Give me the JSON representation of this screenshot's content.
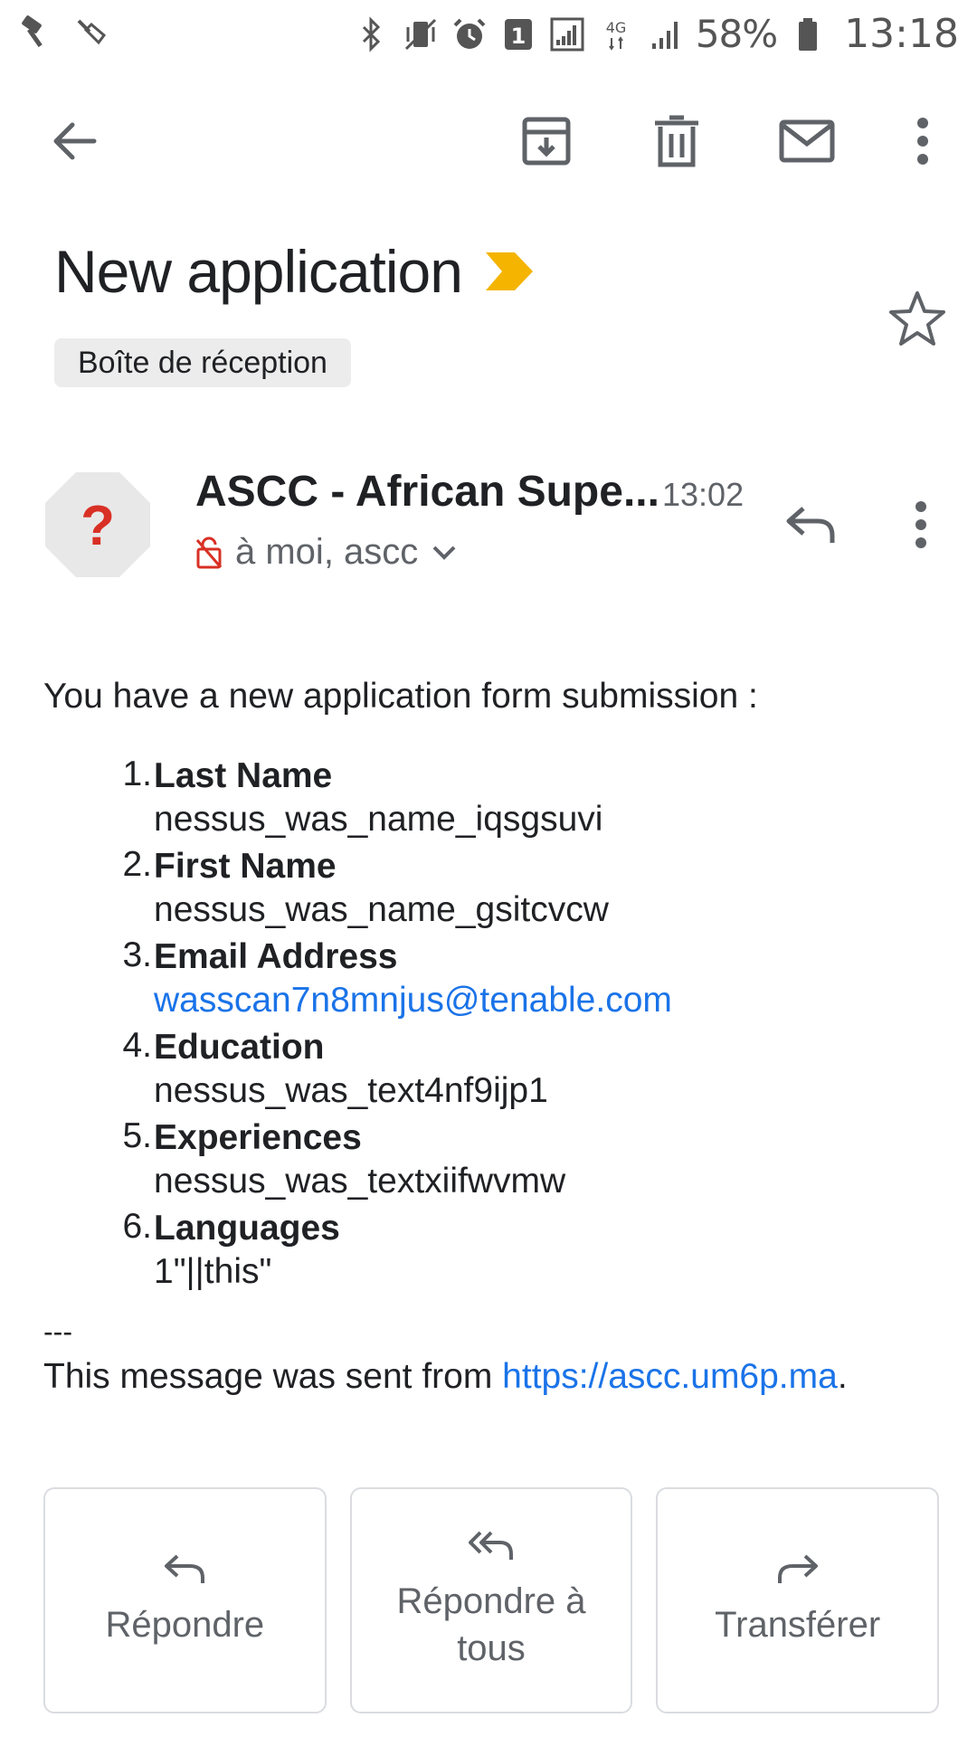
{
  "status_bar": {
    "battery": "58%",
    "time": "13:18",
    "network": "4G",
    "notification_count": "1",
    "icons": [
      "hammer-icon",
      "broom-icon",
      "bluetooth-icon",
      "vibrate-icon",
      "alarm-icon",
      "notification-badge-icon",
      "signal-icon",
      "network-4g-icon",
      "signal-bars-icon",
      "battery-icon"
    ]
  },
  "toolbar": {
    "icons": [
      "back-arrow-icon",
      "archive-icon",
      "trash-icon",
      "mail-icon",
      "more-vert-icon"
    ]
  },
  "email": {
    "subject": "New application",
    "label": "Boîte de réception",
    "sender_name": "ASCC - African Supe...",
    "time": "13:02",
    "recipients": "à moi, ascc",
    "intro": "You have a new application form submission :",
    "fields": [
      {
        "num": "1.",
        "label": "Last Name",
        "value": "nessus_was_name_iqsgsuvi"
      },
      {
        "num": "2.",
        "label": "First Name",
        "value": "nessus_was_name_gsitcvcw"
      },
      {
        "num": "3.",
        "label": "Email Address",
        "value": "wasscan7n8mnjus@tenable.com"
      },
      {
        "num": "4.",
        "label": "Education",
        "value": "nessus_was_text4nf9ijp1"
      },
      {
        "num": "5.",
        "label": "Experiences",
        "value": "nessus_was_textxiifwvmw"
      },
      {
        "num": "6.",
        "label": "Languages",
        "value": "1\"||this\""
      }
    ],
    "separator": "---",
    "footer_prefix": "This message was sent from ",
    "footer_link": "https://ascc.um6p.ma",
    "footer_suffix": "."
  },
  "actions": {
    "reply": "Répondre",
    "reply_all": "Répondre à tous",
    "forward": "Transférer"
  },
  "colors": {
    "link": "#1a73e8",
    "importance": "#f4b400",
    "avatar_bg": "#e8e8e8",
    "avatar_mark": "#d93025"
  }
}
